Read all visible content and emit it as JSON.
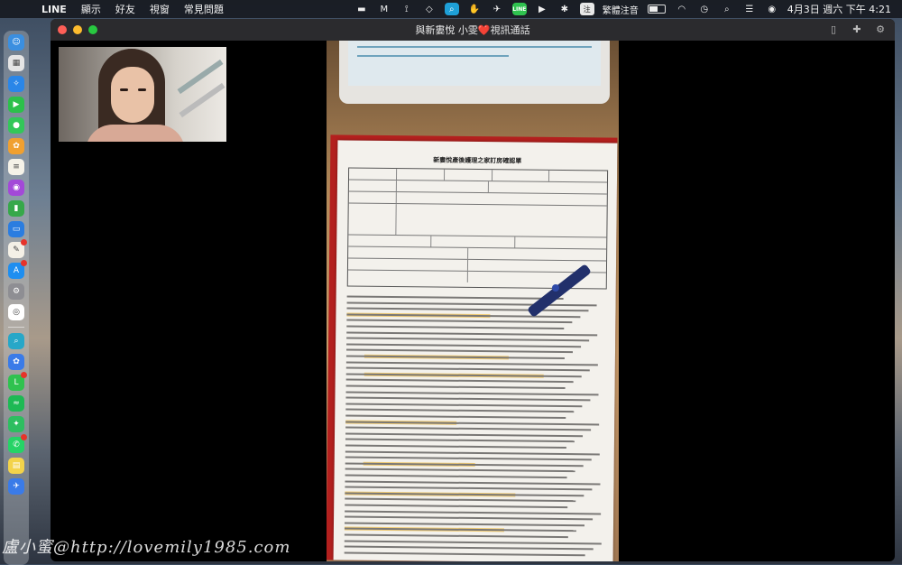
{
  "menubar": {
    "app_name": "LINE",
    "menus": [
      "顯示",
      "好友",
      "視窗",
      "常見問題"
    ],
    "ime_label": "繁體注音",
    "clock": "4月3日 週六 下午 4:21",
    "battery_level": 0.55
  },
  "tray_icons": [
    "screen-icon",
    "m-app-icon",
    "usb-icon",
    "dropbox-icon",
    "search-app-icon",
    "hand-icon",
    "bird-icon",
    "line-icon",
    "play-icon",
    "bluetooth-icon",
    "ime-icon",
    "battery-icon",
    "wifi-icon",
    "clock-icon",
    "spotlight-icon",
    "control-center-icon",
    "siri-icon",
    "notification-icon"
  ],
  "dock_apps": [
    {
      "name": "finder-app-icon",
      "color": "#3b8fe0",
      "glyph": "☺"
    },
    {
      "name": "launchpad-app-icon",
      "color": "#e5e5e5",
      "glyph": "▦"
    },
    {
      "name": "safari-app-icon",
      "color": "#2a86e8",
      "glyph": "✧"
    },
    {
      "name": "facetime-app-icon",
      "color": "#2cc04a",
      "glyph": "▶"
    },
    {
      "name": "messages-app-icon",
      "color": "#33c759",
      "glyph": "●"
    },
    {
      "name": "photos-app-icon",
      "color": "#f0a030",
      "glyph": "✿"
    },
    {
      "name": "notes-app-icon",
      "color": "#f5f2e8",
      "glyph": "≡"
    },
    {
      "name": "podcasts-app-icon",
      "color": "#a349d8",
      "glyph": "◉"
    },
    {
      "name": "numbers-app-icon",
      "color": "#36a84a",
      "glyph": "▮"
    },
    {
      "name": "keynote-app-icon",
      "color": "#2b7de0",
      "glyph": "▭"
    },
    {
      "name": "pencil-app-icon",
      "color": "#f4f0e6",
      "glyph": "✎"
    },
    {
      "name": "appstore-app-icon",
      "color": "#1e8ef0",
      "glyph": "A"
    },
    {
      "name": "settings-app-icon",
      "color": "#8e8e93",
      "glyph": "⚙"
    },
    {
      "name": "chrome-app-icon",
      "color": "#ffffff",
      "glyph": "◎"
    },
    {
      "name": "search-tool-app-icon",
      "color": "#27a7c8",
      "glyph": "⌕"
    },
    {
      "name": "cloud-app-icon",
      "color": "#3a7be8",
      "glyph": "✿"
    },
    {
      "name": "line-app-icon",
      "color": "#2fc24f",
      "glyph": "L"
    },
    {
      "name": "spotify-app-icon",
      "color": "#1db954",
      "glyph": "≈"
    },
    {
      "name": "evernote-app-icon",
      "color": "#2dbe60",
      "glyph": "✦"
    },
    {
      "name": "whatsapp-app-icon",
      "color": "#25d366",
      "glyph": "✆"
    },
    {
      "name": "stickies-app-icon",
      "color": "#f3d34a",
      "glyph": "▤"
    },
    {
      "name": "airmail-app-icon",
      "color": "#3a7be8",
      "glyph": "✈"
    }
  ],
  "window": {
    "title_prefix": "與新婁悅 小雯",
    "title_heart": "❤️",
    "title_suffix": "視訊通話"
  },
  "document": {
    "title": "新婁悅產後護理之家訂房確認單"
  },
  "watermark": "盧小蜜@http://lovemily1985.com"
}
